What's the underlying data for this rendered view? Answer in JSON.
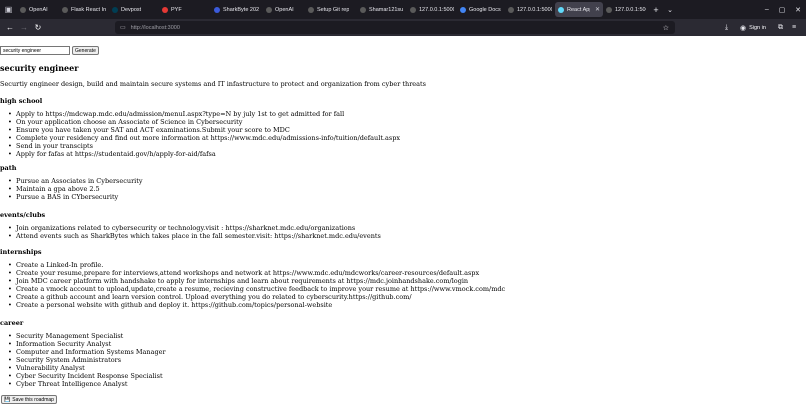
{
  "browser": {
    "tabs": [
      {
        "label": "OpenAI",
        "icon": "openai-icon",
        "color": "#5a5a5a",
        "active": false
      },
      {
        "label": "Flask React In",
        "icon": "page-icon",
        "color": "#5a5a5a",
        "active": false
      },
      {
        "label": "Devpost",
        "icon": "devpost-icon",
        "color": "#003e54",
        "active": false
      },
      {
        "label": "PYF",
        "icon": "pyf-icon",
        "color": "#e53935",
        "active": false
      },
      {
        "label": "SharkByte 202",
        "icon": "sharkbyte-icon",
        "color": "#3b5bdb",
        "active": false
      },
      {
        "label": "OpenAI",
        "icon": "openai-icon",
        "color": "#5a5a5a",
        "active": false
      },
      {
        "label": "Setup Git rep",
        "icon": "gear-icon",
        "color": "#5a5a5a",
        "active": false
      },
      {
        "label": "Shamar121su",
        "icon": "github-icon",
        "color": "#5a5a5a",
        "active": false
      },
      {
        "label": "127.0.0.1:5000/",
        "icon": "page-icon",
        "color": "#5a5a5a",
        "active": false
      },
      {
        "label": "Google Docs",
        "icon": "docs-icon",
        "color": "#4285f4",
        "active": false
      },
      {
        "label": "127.0.0.1:5000/",
        "icon": "page-icon",
        "color": "#5a5a5a",
        "active": false
      },
      {
        "label": "React App",
        "icon": "react-icon",
        "color": "#61dafb",
        "active": true
      },
      {
        "label": "127.0.0.1:5000/",
        "icon": "page-icon",
        "color": "#5a5a5a",
        "active": false
      }
    ],
    "url": "http://localhost:3000",
    "signin_label": "Sign in"
  },
  "page": {
    "role_input_value": "security engineer",
    "generate_label": "Generate",
    "role_title": "security engineer",
    "role_description": "Securtiy engineer design, build and maintain secure systems and IT infastructure to protect and organization from cyber threats",
    "sections": [
      {
        "heading": "high school",
        "items": [
          "Apply to https://mdcwap.mdc.edu/admission/menuI.aspx?type=N by july 1st to get admitted for fall",
          "On your application choose an Associate of Science in Cybersecurity",
          "Ensure you have taken your SAT and ACT examinations.Submit your score to MDC",
          "Complete your residency and find out more information at https://www.mdc.edu/admissions-info/tuition/default.aspx",
          "Send in your transcipts",
          "Apply for fafas at https://studentaid.gov/h/apply-for-aid/fafsa"
        ]
      },
      {
        "heading": "path",
        "items": [
          "Pursue an Associates in Cybersecurity",
          "Maintain a gpa above 2.5",
          "Pursue a BAS in CYbersecurity"
        ]
      },
      {
        "heading": "events/clubs",
        "items": [
          "Join organizations related to cybersecurity or technology.visit : https://sharknet.mdc.edu/organizations",
          "Attend events such as SharkBytes which takes place in the fall semester.visit: https://sharknet.mdc.edu/events"
        ]
      },
      {
        "heading": "internships",
        "items": [
          "Create a Linked-In profile.",
          "Create your resume,prepare for interviews,attend workshops and network at https://www.mdc.edu/mdcworks/career-resources/default.aspx",
          "Join MDC career platform with handshake to apply for internships and learn about requirements at https://mdc.joinhandshake.com/login",
          "Create a vmock account to upload,update,create a resume, recieving constructive feedback to improve your resume at https://www.vmock.com/mdc",
          "Create a github account and learn version control. Upload everything you do related to cyberscurity.https://github.com/",
          "Create a personal website with github and deploy it. https://github.com/topics/personal-website"
        ]
      },
      {
        "heading": "career",
        "items": [
          "Security Management Specialist",
          "Information Security Analyst",
          "Computer and Information Systems Manager",
          "Security System Administrators",
          "Vulnerability Analyst",
          "Cyber Security Incident Response Specialist",
          "Cyber Threat Intelligence Analyst"
        ]
      }
    ],
    "save_label": "Save this roadmap"
  }
}
